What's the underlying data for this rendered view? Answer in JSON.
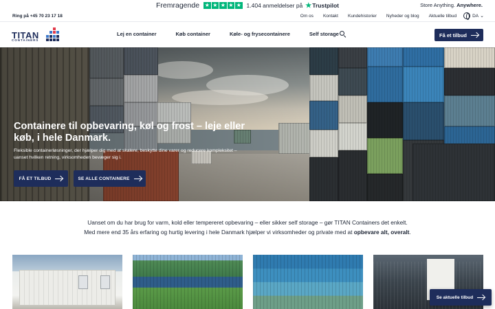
{
  "trustpilot": {
    "rating_word": "Fremragende",
    "review_count": "1.404 anmeldelser på",
    "brand": "Trustpilot",
    "stars": 5,
    "star_color": "#00b67a"
  },
  "tagline": {
    "prefix": "Store Anything.",
    "emphasis": "Anywhere."
  },
  "utility": {
    "phone": "Ring på +45 70 23 17 18",
    "links": [
      "Om os",
      "Kontakt",
      "Kundehistorier",
      "Nyheder og blog",
      "Aktuelle tilbud"
    ],
    "language": "DA"
  },
  "nav": {
    "logo_text": "TITAN",
    "logo_sub": "CONTAINERS",
    "items": [
      "Lej en container",
      "Køb container",
      "Køle- og frysecontainere",
      "Self storage"
    ],
    "cta": "Få et tilbud"
  },
  "hero": {
    "title": "Containere til opbevaring, køl og frost – leje eller køb, i hele Danmark.",
    "description": "Fleksible containerløsninger, der hjælper dig med at skalere, beskytte dine varer og reducere kompleksitet – uanset hvilken retning, virksomheden bevæger sig i.",
    "primary_button": "FÅ ET TILBUD",
    "secondary_button": "SE ALLE CONTAINERE"
  },
  "intro": {
    "line1": "Uanset om du har brug for varm, kold eller tempereret opbevaring – eller sikker self storage – gør TITAN Containers det enkelt.",
    "line2_prefix": "Med mere end 35 års erfaring og hurtig levering i hele Danmark hjælper vi virksomheder og private med at",
    "line2_bold": "opbevare alt, overalt",
    "line2_suffix": "."
  },
  "floating_button": "Se aktuelle tilbud",
  "colors": {
    "brand_navy": "#1e2d5b",
    "brand_red": "#e23a4b",
    "trustpilot_green": "#00b67a"
  }
}
